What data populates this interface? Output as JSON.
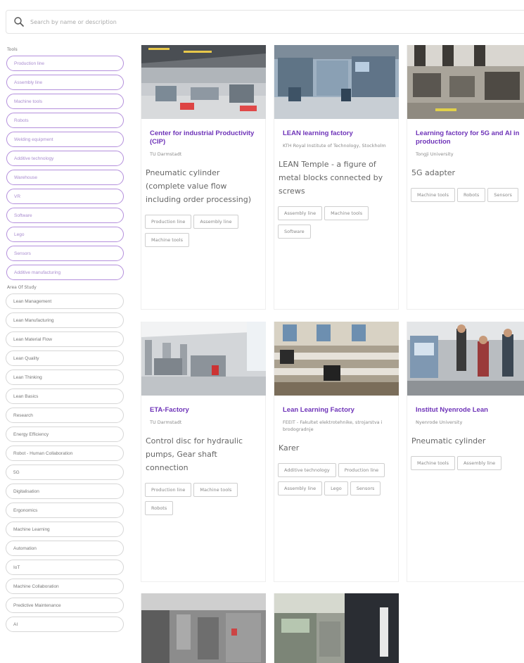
{
  "search": {
    "placeholder": "Search by name or description"
  },
  "sidebar": {
    "tools_heading": "Tools",
    "tools": [
      "Production line",
      "Assembly line",
      "Machine tools",
      "Robots",
      "Welding equipment",
      "Additive technology",
      "Warehouse",
      "VR",
      "Software",
      "Lego",
      "Sensors",
      "Additive manufacturing"
    ],
    "area_heading": "Area Of Study",
    "areas": [
      "Lean Management",
      "Lean Manufacturing",
      "Lean Material Flow",
      "Lean Quality",
      "Lean Thinking",
      "Lean Basics",
      "Research",
      "Energy Efficiency",
      "Robot - Human Collaboration",
      "5G",
      "Digitalisation",
      "Ergonomics",
      "Machine Learning",
      "Automation",
      "IoT",
      "Machine Collaboration",
      "Predictive Maintenance",
      "AI"
    ]
  },
  "cards": [
    {
      "title": "Center for industrial Productivity (CIP)",
      "org": "TU Darmstadt",
      "description": "Pneumatic cylinder (complete value flow including order processing)",
      "tags": [
        "Production line",
        "Assembly line",
        "Machine tools"
      ]
    },
    {
      "title": "LEAN learning factory",
      "org": "KTH Royal Institute of Technology, Stockholm",
      "description": "LEAN Temple - a figure of metal blocks connected by screws",
      "tags": [
        "Assembly line",
        "Machine tools",
        "Software"
      ]
    },
    {
      "title": "Learning factory for 5G and AI in production",
      "org": "Tongji University",
      "description": "5G adapter",
      "tags": [
        "Machine tools",
        "Robots",
        "Sensors"
      ]
    },
    {
      "title": "ETA-Factory",
      "org": "TU Darmstadt",
      "description": "Control disc for hydraulic pumps, Gear shaft connection",
      "tags": [
        "Production line",
        "Machine tools",
        "Robots"
      ]
    },
    {
      "title": "Lean Learning Factory",
      "org": "FEEIT - Fakultet elektrotehnike, strojarstva i brodogradnje",
      "description": "Karer",
      "tags": [
        "Additive technology",
        "Production line",
        "Assembly line",
        "Lego",
        "Sensors"
      ]
    },
    {
      "title": "Institut Nyenrode Lean",
      "org": "Nyenrode University",
      "description": "Pneumatic cylinder",
      "tags": [
        "Machine tools",
        "Assembly line"
      ]
    },
    {
      "title": "",
      "org": "",
      "description": "",
      "tags": []
    },
    {
      "title": "",
      "org": "",
      "description": "",
      "tags": []
    }
  ],
  "colors": {
    "accent": "#6e33b8",
    "chip_border": "#b48fdc",
    "tag_border": "#cfcfcf"
  }
}
